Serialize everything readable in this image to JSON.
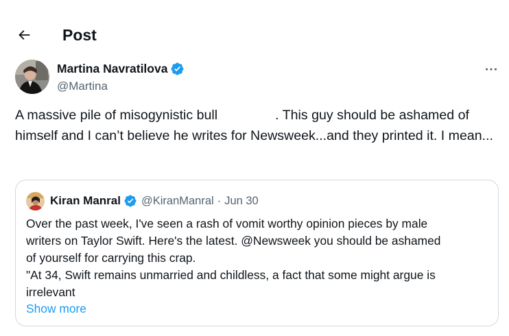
{
  "header": {
    "back_icon": "arrow-left-icon",
    "title": "Post"
  },
  "post": {
    "author_name": "Martina Navratilova",
    "author_handle": "@Martina",
    "verified_icon": "verified-badge-icon",
    "more_icon": "more-horizontal-icon",
    "text_part1": "A massive pile of misogynistic bull",
    "text_part2": ". This guy should be ashamed of himself and I can’t believe he writes for Newsweek...and they printed it. I mean..."
  },
  "quote": {
    "author_name": "Kiran Manral",
    "author_handle": "@KiranManral",
    "separator": "·",
    "date": "Jun 30",
    "lines": [
      "Over the past week, I've seen a rash of vomit worthy opinion pieces by male",
      "writers on Taylor Swift. Here's the latest. @Newsweek you should be ashamed",
      "of yourself for carrying this crap.",
      "\"At 34, Swift remains unmarried and childless, a fact that some might  argue is",
      "irrelevant"
    ],
    "show_more": "Show more"
  },
  "colors": {
    "text": "#0f1419",
    "secondary": "#536471",
    "accent": "#1d9bf0",
    "border": "#cfd9de"
  }
}
